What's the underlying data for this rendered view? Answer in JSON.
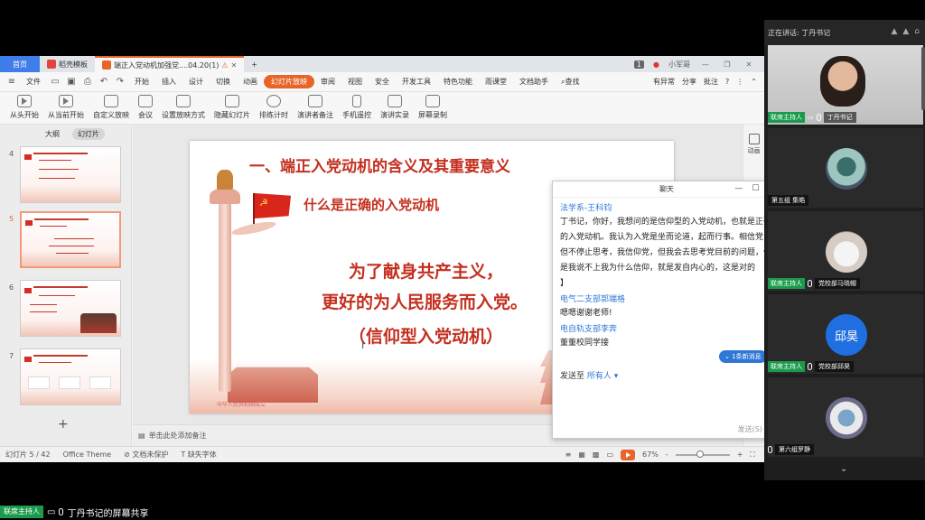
{
  "tabs": {
    "home": "首页",
    "template": "稻壳模板",
    "document": "端正入党动机加强党....04.20(1)",
    "new_tab": "+",
    "badge": "1",
    "user": "小军哥"
  },
  "menu": {
    "file": "文件",
    "items": [
      "开始",
      "插入",
      "设计",
      "切换",
      "动画",
      "幻灯片放映",
      "审阅",
      "视图",
      "安全",
      "开发工具",
      "特色功能",
      "雨课堂",
      "文档助手"
    ],
    "search": "查找",
    "unsaved": "有异常",
    "share": "分享",
    "comment": "批注",
    "help": "?"
  },
  "ribbon": [
    "从头开始",
    "从当前开始",
    "自定义放映",
    "会议",
    "设置放映方式",
    "隐藏幻灯片",
    "排练计时",
    "演讲者备注",
    "手机遥控",
    "演讲实录",
    "屏幕录制"
  ],
  "slides_panel": {
    "tab_outline": "大纲",
    "tab_slides": "幻灯片",
    "numbers": [
      "4",
      "5",
      "6",
      "7"
    ],
    "add": "+"
  },
  "slide": {
    "title": "一、端正入党动机的含义及其重要意义",
    "subtitle": "什么是正确的入党动机",
    "line1": "为了献身共产主义，",
    "line2": "更好的为人民服务而入党。",
    "line3": "（信仰型入党动机）",
    "caption": "中华人民共和国成立"
  },
  "notes_placeholder": "单击此处添加备注",
  "side_right": {
    "label": "动画"
  },
  "status": {
    "slide_pos": "幻灯片 5 / 42",
    "theme": "Office Theme",
    "protect": "文档未保护",
    "font_missing": "缺失字体",
    "zoom": "67%",
    "zoom_level": 0.45,
    "minus": "-",
    "plus": "+"
  },
  "chat": {
    "title": "聊天",
    "messages": [
      {
        "sender": "法学系-王科钧",
        "text": "丁书记，你好，我想问的是信仰型的入党动机，也就是正确的入党动机。我认为入党是坐而论道，起而行事。相信党，但不停止思考，我信仰党，但我会去思考党目前的问题，但是我说不上我为什么信仰，就是发自内心的，这是对的"
      },
      {
        "sender": "",
        "text": "】"
      },
      {
        "sender": "电气二支部郭端格",
        "text": "嗯嗯谢谢老师!"
      },
      {
        "sender": "电自轨支部李奔",
        "text": "董董校同学接"
      }
    ],
    "new_msg": "1条新消息",
    "send_to_label": "发送至",
    "send_to_target": "所有人",
    "send_button": "发送(S)"
  },
  "meeting": {
    "speaking": "正在讲话: 丁丹书记",
    "host_badge": "联席主持人",
    "participants": [
      {
        "name": "丁丹书记",
        "host": true
      },
      {
        "name": "第五组 集皓",
        "host": false
      },
      {
        "name": "党校部马晓帽",
        "host": true
      },
      {
        "name": "党校部邱昊",
        "host": true,
        "avatar_text": "邱昊"
      },
      {
        "name": "第六组罗静",
        "host": false
      }
    ]
  },
  "sharebar": {
    "host_badge": "联席主持人",
    "text": "丁丹书记的屏幕共享"
  }
}
